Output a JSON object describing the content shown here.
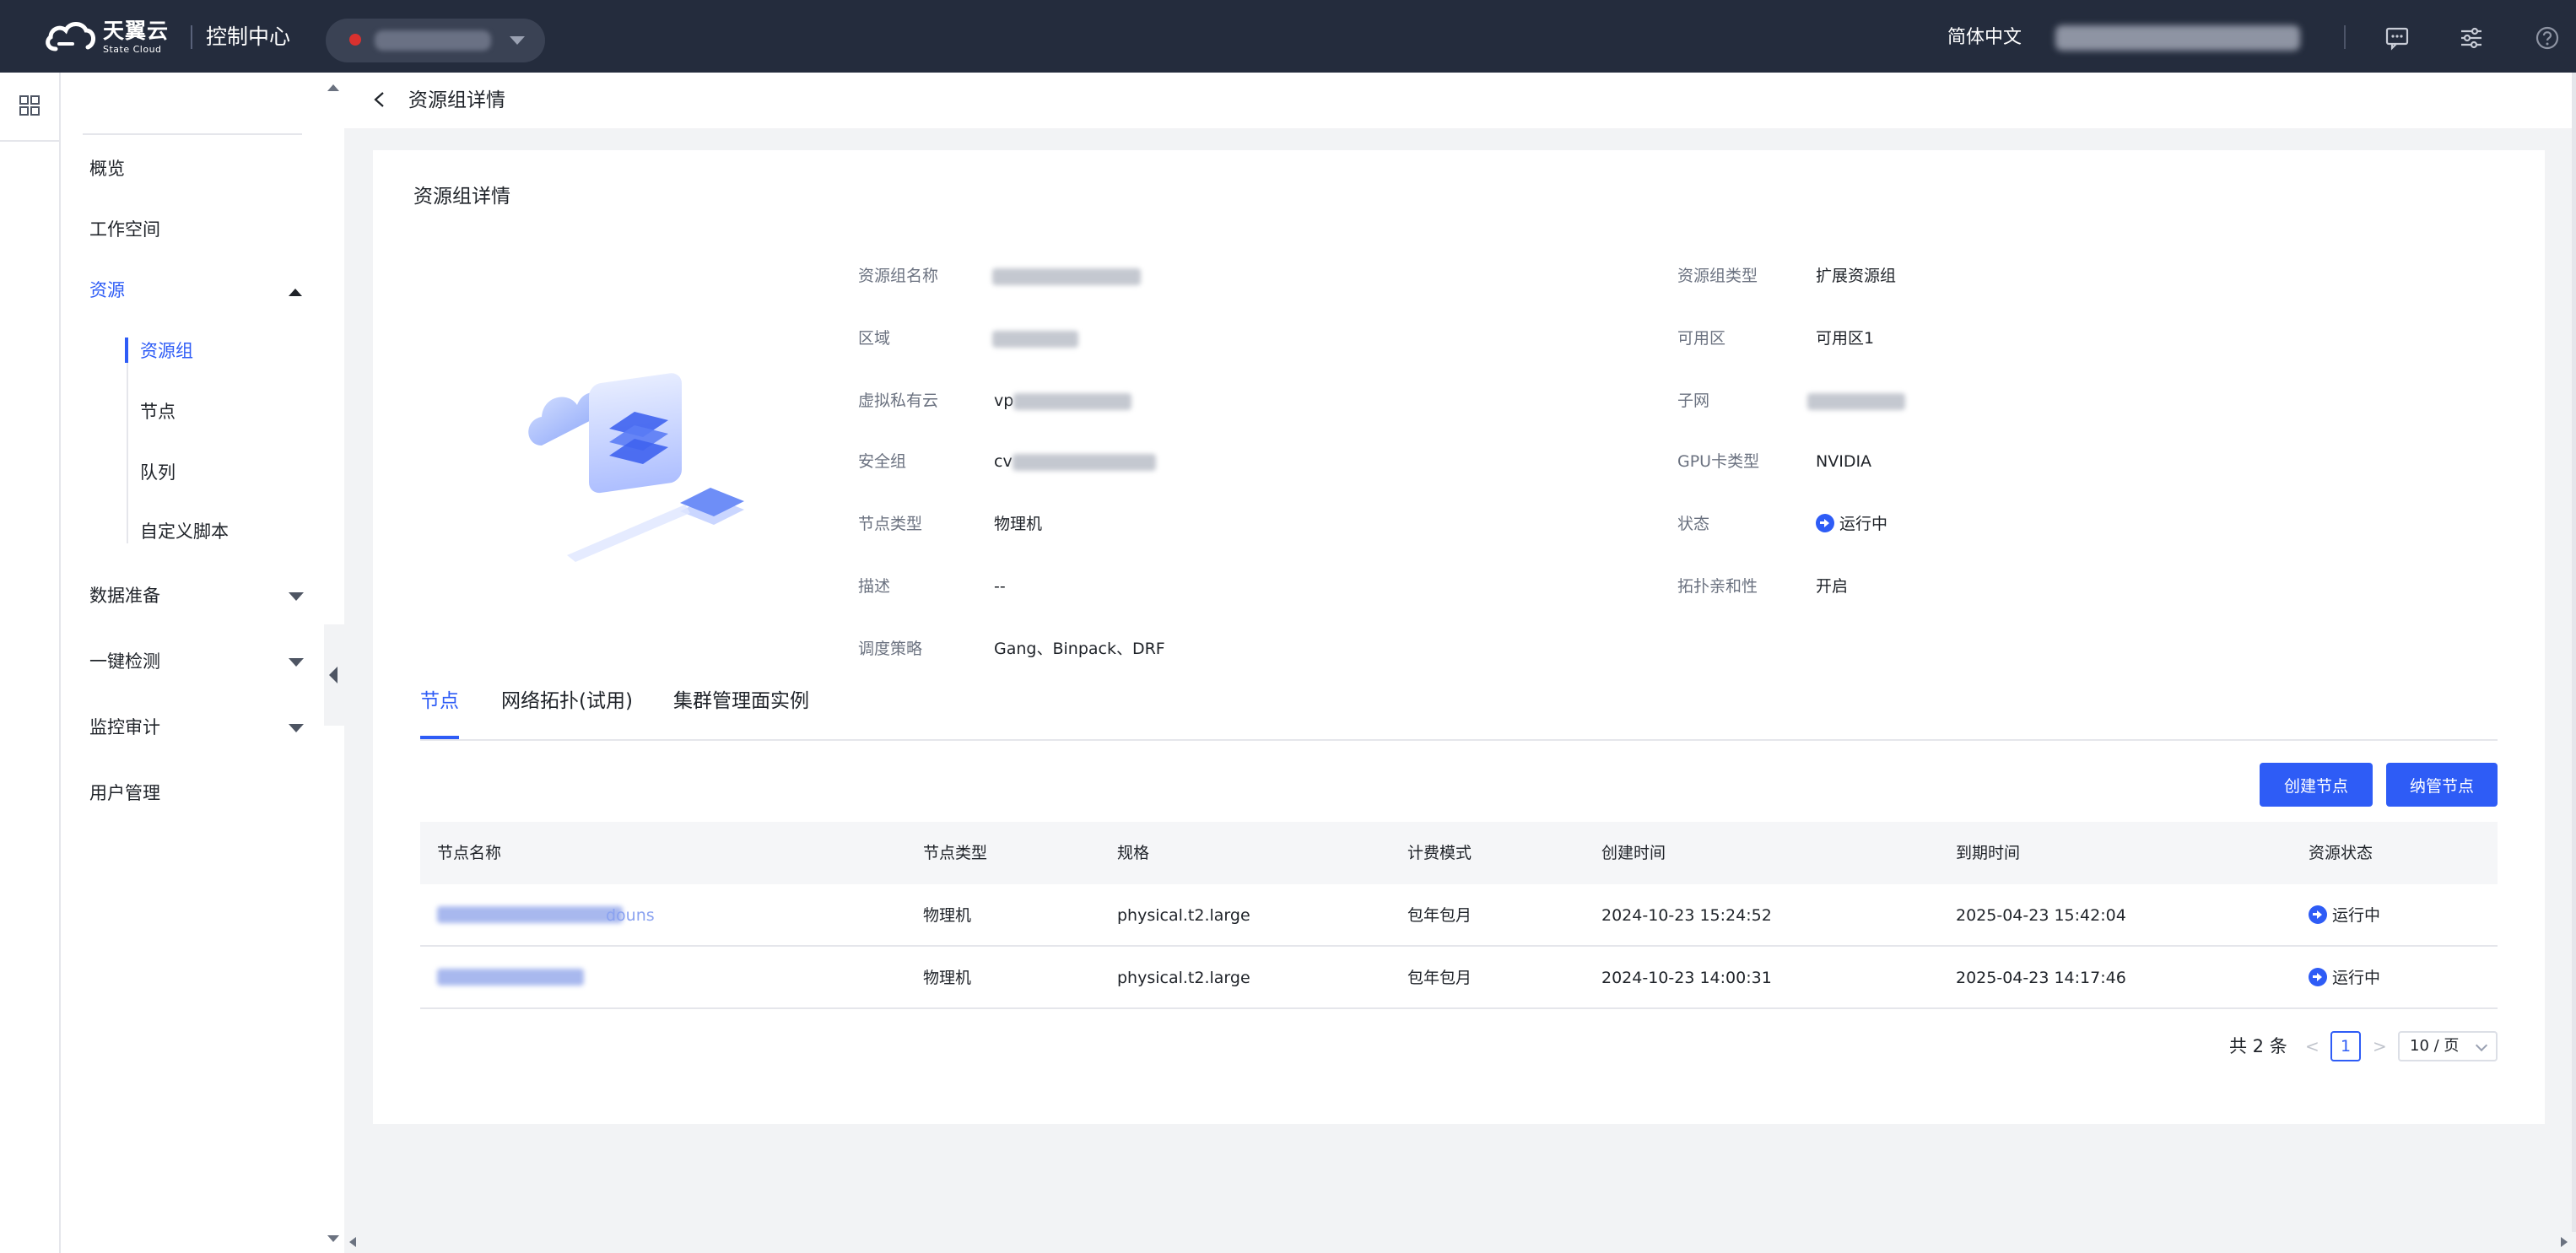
{
  "header": {
    "logo_cn": "天翼云",
    "logo_en": "State Cloud",
    "console_title": "控制中心",
    "language": "简体中文",
    "icons": [
      "message-icon",
      "settings-sliders-icon",
      "help-icon"
    ]
  },
  "rail": {
    "icon": "grid-apps-icon"
  },
  "menu": {
    "overview": "概览",
    "workspace": "工作空间",
    "resources": "资源",
    "resource_sub": [
      "资源组",
      "节点",
      "队列",
      "自定义脚本"
    ],
    "data_prep": "数据准备",
    "one_click": "一键检测",
    "monitor": "监控审计",
    "user_mgmt": "用户管理"
  },
  "breadcrumb": {
    "title": "资源组详情"
  },
  "card": {
    "title": "资源组详情",
    "left": {
      "name_label": "资源组名称",
      "region_label": "区域",
      "vpc_label": "虚拟私有云",
      "vpc_prefix": "vp",
      "sg_label": "安全组",
      "sg_prefix": "cv",
      "node_type_label": "节点类型",
      "node_type_value": "物理机",
      "desc_label": "描述",
      "desc_value": "--",
      "policy_label": "调度策略",
      "policy_value": "Gang、Binpack、DRF"
    },
    "right": {
      "type_label": "资源组类型",
      "type_value": "扩展资源组",
      "az_label": "可用区",
      "az_value": "可用区1",
      "subnet_label": "子网",
      "gpu_label": "GPU卡类型",
      "gpu_value": "NVIDIA",
      "status_label": "状态",
      "status_value": "运行中",
      "topo_label": "拓扑亲和性",
      "topo_value": "开启"
    }
  },
  "tabs": [
    "节点",
    "网络拓扑(试用)",
    "集群管理面实例"
  ],
  "buttons": {
    "create": "创建节点",
    "manage": "纳管节点"
  },
  "table": {
    "headers": [
      "节点名称",
      "节点类型",
      "规格",
      "计费模式",
      "创建时间",
      "到期时间",
      "资源状态"
    ],
    "rows": [
      {
        "name_suffix": "douns",
        "type": "物理机",
        "spec": "physical.t2.large",
        "billing": "包年包月",
        "created": "2024-10-23 15:24:52",
        "expires": "2025-04-23 15:42:04",
        "status": "运行中"
      },
      {
        "name_suffix": "",
        "type": "物理机",
        "spec": "physical.t2.large",
        "billing": "包年包月",
        "created": "2024-10-23 14:00:31",
        "expires": "2025-04-23 14:17:46",
        "status": "运行中"
      }
    ]
  },
  "pagination": {
    "total": "共 2 条",
    "current": "1",
    "page_size": "10 / 页",
    "prev": "<",
    "next": ">"
  },
  "colors": {
    "topbar": "#242c3d",
    "accent": "#2e5cf6"
  }
}
